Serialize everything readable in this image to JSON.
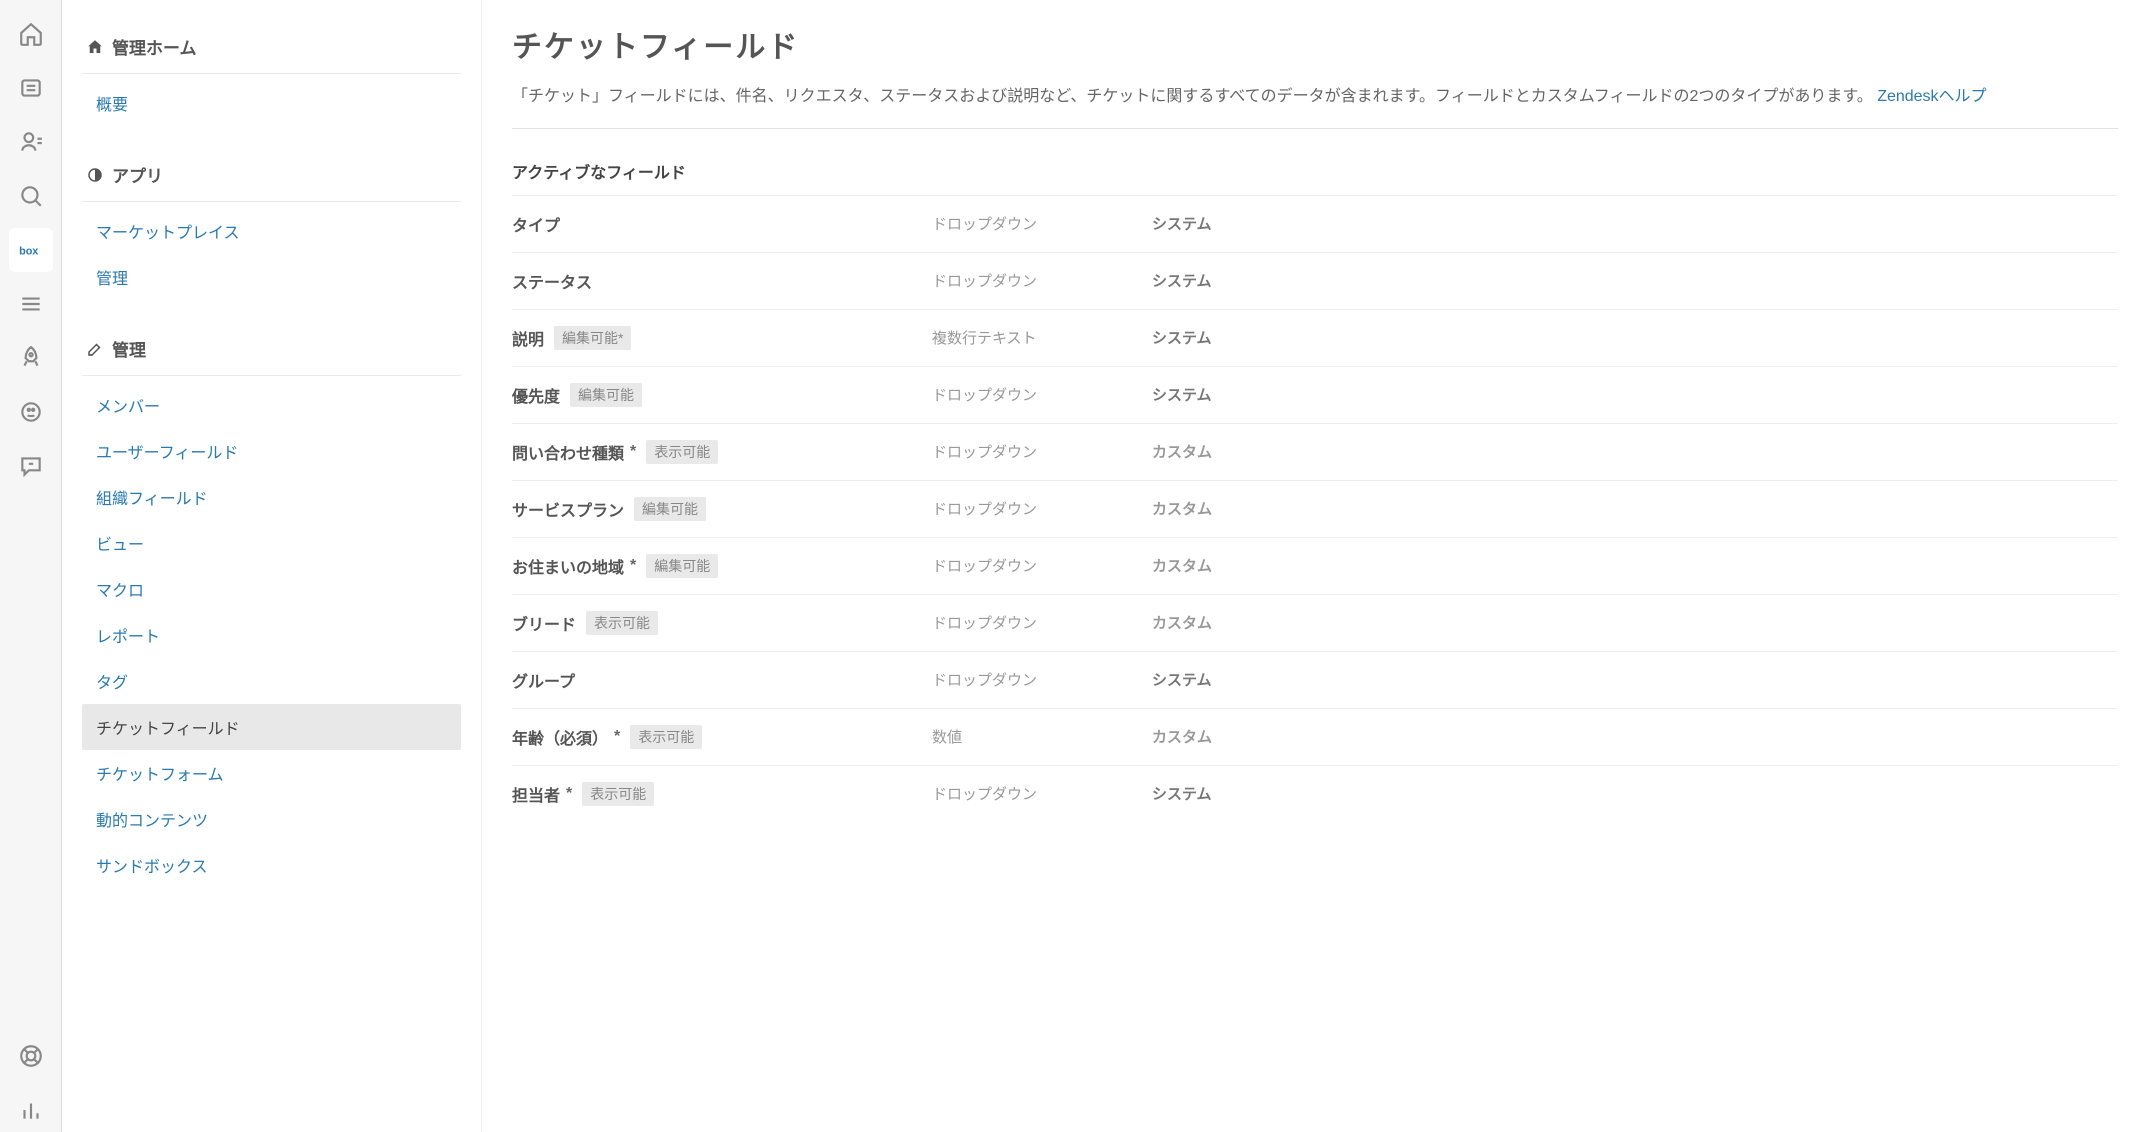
{
  "sidebar": {
    "admin_home": "管理ホーム",
    "overview": "概要",
    "apps_header": "アプリ",
    "apps_items": [
      "マーケットプレイス",
      "管理"
    ],
    "manage_header": "管理",
    "manage_items": [
      "メンバー",
      "ユーザーフィールド",
      "組織フィールド",
      "ビュー",
      "マクロ",
      "レポート",
      "タグ",
      "チケットフィールド",
      "チケットフォーム",
      "動的コンテンツ",
      "サンドボックス"
    ],
    "selected_manage_index": 7
  },
  "main": {
    "title": "チケットフィールド",
    "desc_before": "「チケット」フィールドには、件名、リクエスタ、ステータスおよび説明など、チケットに関するすべてのデータが含まれます。フィールドとカスタムフィールドの2つのタイプがあります。 ",
    "help_link": "Zendeskヘルプ",
    "active_header": "アクティブなフィールド",
    "type_labels": {
      "dropdown": "ドロップダウン",
      "multiline": "複数行テキスト",
      "number": "数値"
    },
    "source_labels": {
      "system": "システム",
      "custom": "カスタム"
    },
    "badge_labels": {
      "editable": "編集可能*",
      "editable_nostar": "編集可能",
      "visible": "表示可能"
    },
    "fields": [
      {
        "name": "タイプ",
        "req": false,
        "badge": null,
        "type": "dropdown",
        "source": "system"
      },
      {
        "name": "ステータス",
        "req": false,
        "badge": null,
        "type": "dropdown",
        "source": "system"
      },
      {
        "name": "説明",
        "req": false,
        "badge": "editable",
        "type": "multiline",
        "source": "system"
      },
      {
        "name": "優先度",
        "req": false,
        "badge": "editable_nostar",
        "type": "dropdown",
        "source": "system"
      },
      {
        "name": "問い合わせ種類",
        "req": true,
        "badge": "visible",
        "type": "dropdown",
        "source": "custom"
      },
      {
        "name": "サービスプラン",
        "req": false,
        "badge": "editable_nostar",
        "type": "dropdown",
        "source": "custom"
      },
      {
        "name": "お住まいの地域",
        "req": true,
        "badge": "editable_nostar",
        "type": "dropdown",
        "source": "custom"
      },
      {
        "name": "ブリード",
        "req": false,
        "badge": "visible",
        "type": "dropdown",
        "source": "custom"
      },
      {
        "name": "グループ",
        "req": false,
        "badge": null,
        "type": "dropdown",
        "source": "system"
      },
      {
        "name": "年齢（必須）",
        "req": true,
        "badge": "visible",
        "type": "number",
        "source": "custom"
      },
      {
        "name": "担当者",
        "req": true,
        "badge": "visible",
        "type": "dropdown",
        "source": "system"
      }
    ]
  }
}
